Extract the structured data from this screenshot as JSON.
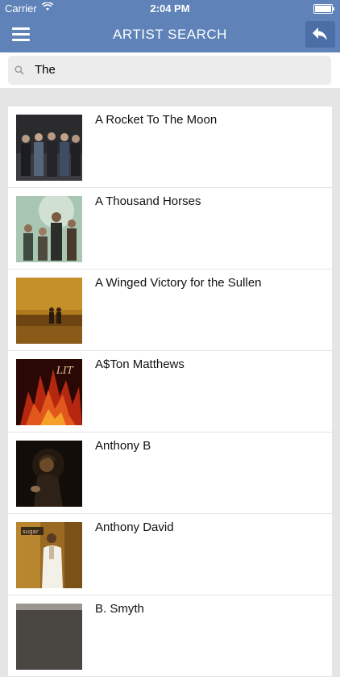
{
  "status_bar": {
    "carrier": "Carrier",
    "time": "2:04 PM"
  },
  "navbar": {
    "title": "ARTIST SEARCH",
    "menu_icon": "hamburger-menu-icon",
    "back_icon": "reply-arrow-icon"
  },
  "search": {
    "value": "The",
    "icon": "search-icon"
  },
  "artists": [
    {
      "name": "A Rocket To The Moon"
    },
    {
      "name": "A Thousand Horses"
    },
    {
      "name": "A Winged Victory for the Sullen"
    },
    {
      "name": "A$Ton Matthews"
    },
    {
      "name": "Anthony B"
    },
    {
      "name": "Anthony David"
    },
    {
      "name": "B. Smyth"
    }
  ],
  "colors": {
    "accent": "#5f83b8",
    "back_button": "#4a6ea5",
    "background": "#e5e5e5"
  }
}
